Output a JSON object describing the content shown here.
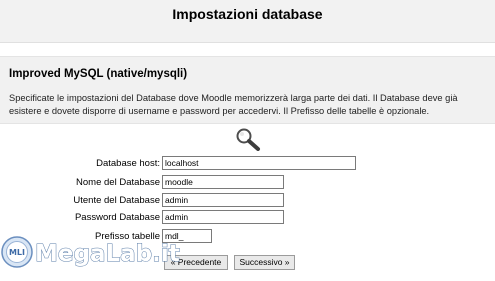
{
  "page": {
    "title": "Impostazioni database"
  },
  "section": {
    "heading": "Improved MySQL (native/mysqli)",
    "description": "Specificate le impostazioni del Database dove Moodle memorizzerà larga parte dei dati. Il Database deve già esistere e dovete disporre di username e password per accedervi. Il Prefisso delle tabelle è opzionale."
  },
  "form": {
    "fields": [
      {
        "label": "Database host:",
        "value": "localhost"
      },
      {
        "label": "Nome del Database",
        "value": "moodle"
      },
      {
        "label": "Utente del Database",
        "value": "admin"
      },
      {
        "label": "Password Database",
        "value": "admin"
      },
      {
        "label": "Prefisso tabelle",
        "value": "mdl_"
      }
    ]
  },
  "buttons": {
    "previous": "« Precedente",
    "next": "Successivo »"
  },
  "icons": {
    "search": "magnifier-icon"
  },
  "watermark": {
    "text": "MegaLab.it",
    "logo": "MLI"
  }
}
